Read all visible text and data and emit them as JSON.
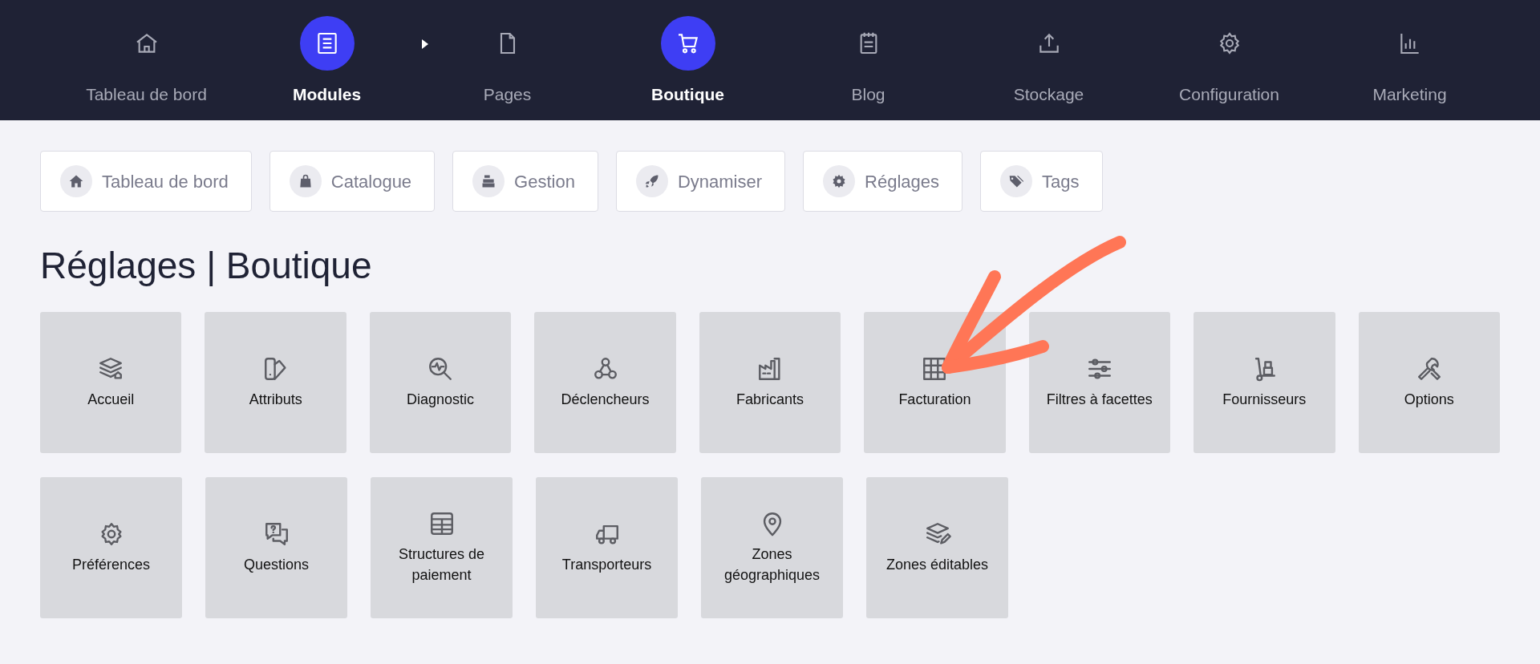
{
  "nav": [
    {
      "label": "Tableau de bord",
      "active": false,
      "submenu_open": false
    },
    {
      "label": "Modules",
      "active": true,
      "submenu_open": true
    },
    {
      "label": "Pages",
      "active": false,
      "submenu_open": false
    },
    {
      "label": "Boutique",
      "active": true,
      "submenu_open": false
    },
    {
      "label": "Blog",
      "active": false,
      "submenu_open": false
    },
    {
      "label": "Stockage",
      "active": false,
      "submenu_open": false
    },
    {
      "label": "Configuration",
      "active": false,
      "submenu_open": false
    },
    {
      "label": "Marketing",
      "active": false,
      "submenu_open": false
    }
  ],
  "tabs": [
    {
      "label": "Tableau de bord"
    },
    {
      "label": "Catalogue"
    },
    {
      "label": "Gestion"
    },
    {
      "label": "Dynamiser"
    },
    {
      "label": "Réglages"
    },
    {
      "label": "Tags"
    }
  ],
  "heading": "Réglages | Boutique",
  "tiles": [
    [
      {
        "label": "Accueil"
      },
      {
        "label": "Attributs"
      },
      {
        "label": "Diagnostic"
      },
      {
        "label": "Déclencheurs"
      },
      {
        "label": "Fabricants"
      },
      {
        "label": "Facturation"
      },
      {
        "label": "Filtres à facettes"
      },
      {
        "label": "Fournisseurs"
      },
      {
        "label": "Options"
      }
    ],
    [
      {
        "label": "Préférences"
      },
      {
        "label": "Questions"
      },
      {
        "label": "Structures de paiement"
      },
      {
        "label": "Transporteurs"
      },
      {
        "label": "Zones géographiques"
      },
      {
        "label": "Zones éditables"
      }
    ]
  ]
}
